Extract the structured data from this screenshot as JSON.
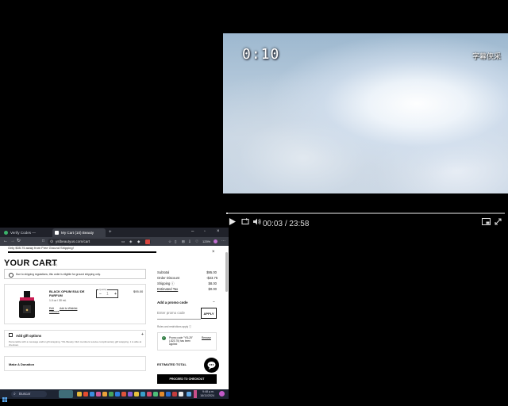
{
  "video": {
    "timecode": "0:10",
    "watermark": "字幕侠采",
    "progress": 0.007,
    "time_current": "00:03",
    "time_sep": "/",
    "time_total": "23:58"
  },
  "browser": {
    "tabs": [
      {
        "label": "Verify Codes — SimplyCodes"
      },
      {
        "label": "My Cart (10) Beauty Makeup..."
      }
    ],
    "new_tab": "+",
    "url": "ysl­beautyus.com/cart",
    "zoom": "125%"
  },
  "cart": {
    "free_shipping_banner": "Only $35.75 away from Free Ground Shipping!",
    "title": "YOUR CART",
    "item_count": "(1 Item)",
    "shipping_notice": "Due to shipping regulations, this order is eligible for ground shipping only.",
    "product": {
      "name": "BLACK OPIUM EAU DE PARFUM",
      "size": "1.0 oz / 30 mL",
      "edit": "Edit",
      "wishlist": "Add to Wishlist",
      "remove": "Remove",
      "quantity_label": "Quantity",
      "quantity": "1",
      "minus": "−",
      "plus": "+",
      "price": "$95.00"
    },
    "gift": {
      "title": "Add gift options",
      "description": "Personalize with a message and/or gift wrapping. YSL Beauty Club members receive complimentary gift wrapping. 1 is able at checkout.",
      "expand": "+"
    },
    "donation": "Make A Donation"
  },
  "summary": {
    "subtotal_label": "Subtotal",
    "subtotal": "$95.00",
    "discount_label": "Order Discount",
    "discount": "-$23.75",
    "shipping_label": "Shipping",
    "shipping": "$8.00",
    "tax_label": "Estimated Tax",
    "tax": "$0.00",
    "promo_heading": "Add a promo code",
    "promo_collapse": "−",
    "promo_placeholder": "Enter promo code",
    "apply": "APPLY",
    "rules": "Rules and restrictions apply",
    "applied_text": "Promo code \"YSL25\" (-$23.75) has been applied",
    "applied_remove": "Remove",
    "estimated_total": "ESTIMATED TOTAL",
    "checkout": "PROCEED TO CHECKOUT"
  },
  "taskbar": {
    "search": "Buscar",
    "time": "9:48 p.m.",
    "date": "16/11/2024"
  },
  "colors": {
    "accent_check": "#2c7a3f",
    "tab_bar": "#20222a",
    "taskbar": "#1e2533"
  }
}
